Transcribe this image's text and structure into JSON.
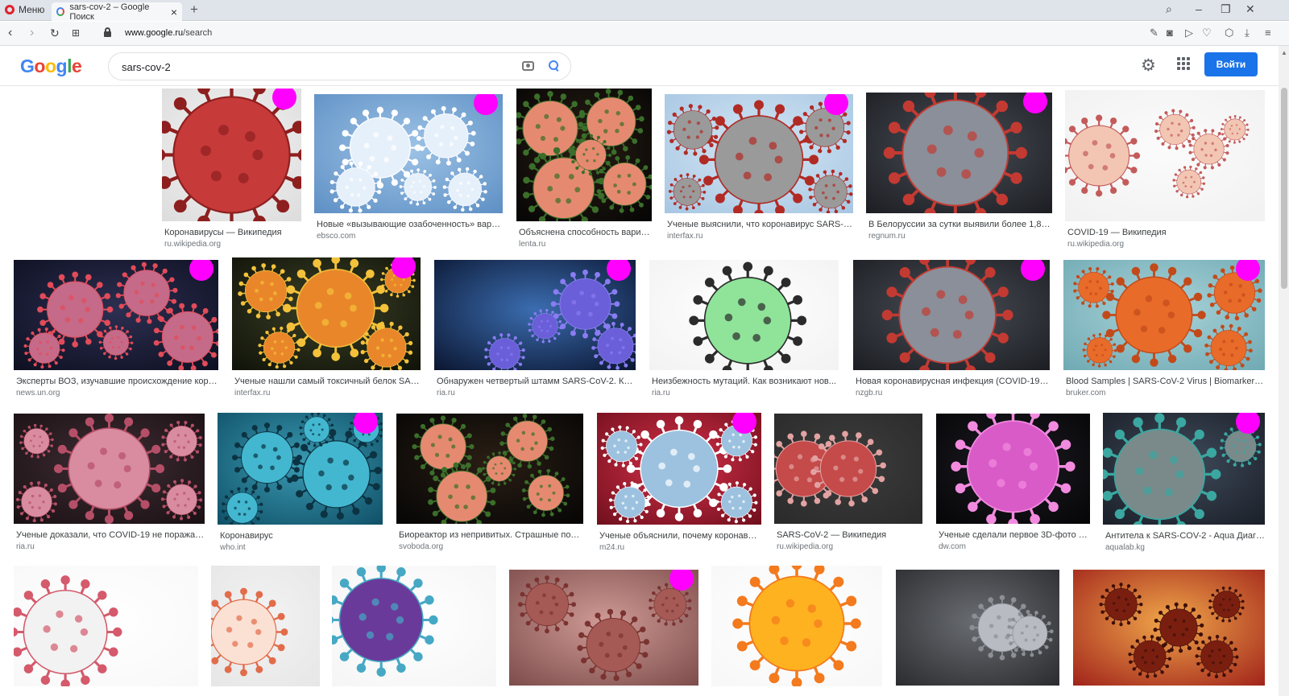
{
  "browser": {
    "menu_label": "Меню",
    "tab_title": "sars-cov-2 – Google Поиск",
    "url_host": "www.google.ru",
    "url_path": "/search"
  },
  "google": {
    "query": "sars-cov-2",
    "signin_label": "Войти"
  },
  "results": [
    {
      "title": "Коронавирусы — Википедия",
      "source": "ru.wikipedia.org",
      "theme": "red-spiky-white"
    },
    {
      "title": "Новые «вызывающие озабоченность» вариан...",
      "source": "ebsco.com",
      "theme": "blue-pale"
    },
    {
      "title": "Объяснена способность вариа...",
      "source": "lenta.ru",
      "theme": "micro-dark"
    },
    {
      "title": "Ученые выяснили, что коронавирус SARS-Co...",
      "source": "interfax.ru",
      "theme": "red-on-lightblue"
    },
    {
      "title": "В Белоруссии за сутки выявили более 1,8 т...",
      "source": "regnum.ru",
      "theme": "red-on-dark"
    },
    {
      "title": "COVID-19 — Википедия",
      "source": "ru.wikipedia.org",
      "theme": "diagram-anatomy"
    },
    {
      "title": "Эксперты ВОЗ, изучавшие происхождение корон...",
      "source": "news.un.org",
      "theme": "purple-dark"
    },
    {
      "title": "Ученые нашли самый токсичный белок SARS...",
      "source": "interfax.ru",
      "theme": "orange-dark"
    },
    {
      "title": "Обнаружен четвертый штамм SARS-CoV-2. Коро...",
      "source": "ria.ru",
      "theme": "earth-blue"
    },
    {
      "title": "Неизбежность мутаций. Как возникают нов...",
      "source": "ria.ru",
      "theme": "diagram-green"
    },
    {
      "title": "Новая коронавирусная инфекция (COVID-19 ) - ...",
      "source": "nzgb.ru",
      "theme": "red-on-dark"
    },
    {
      "title": "Blood Samples | SARS-CoV-2 Virus | Biomarker Iden...",
      "source": "bruker.com",
      "theme": "orange-teal"
    },
    {
      "title": "Ученые доказали, что COVID-19 не поражает ...",
      "source": "ria.ru",
      "theme": "brain-pink"
    },
    {
      "title": "Коронавирус",
      "source": "who.int",
      "theme": "teal"
    },
    {
      "title": "Биореактор из непривитых. Страшные пото...",
      "source": "svoboda.org",
      "theme": "micro-dark"
    },
    {
      "title": "Ученые объяснили, почему коронавир...",
      "source": "m24.ru",
      "theme": "blue-on-red"
    },
    {
      "title": "SARS-CoV-2 — Википедия",
      "source": "ru.wikipedia.org",
      "theme": "diagram-dark"
    },
    {
      "title": "Ученые сделали первое 3D-фото ко...",
      "source": "dw.com",
      "theme": "pink-dark"
    },
    {
      "title": "Антитела к SARS-COV-2 - Aqua Диагнос...",
      "source": "aqualab.kg",
      "theme": "teal-dark"
    },
    {
      "title": "",
      "source": "",
      "theme": "diagram-white"
    },
    {
      "title": "",
      "source": "",
      "theme": "diagram-red"
    },
    {
      "title": "",
      "source": "",
      "theme": "diagram-purple"
    },
    {
      "title": "",
      "source": "",
      "theme": "red-pale"
    },
    {
      "title": "",
      "source": "",
      "theme": "diagram-yellow"
    },
    {
      "title": "",
      "source": "",
      "theme": "gray-photo"
    },
    {
      "title": "",
      "source": "",
      "theme": "orange-red"
    }
  ]
}
